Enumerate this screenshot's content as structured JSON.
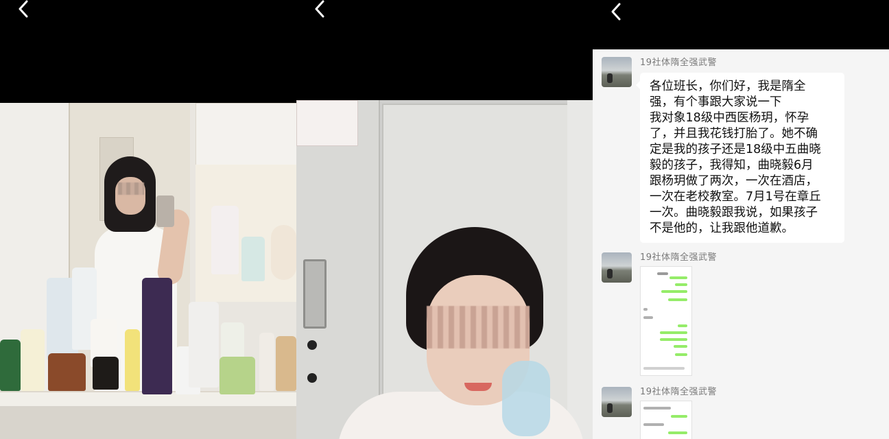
{
  "panels": [
    {
      "back_icon": "chevron-left-icon",
      "photo": "mirror-selfie"
    },
    {
      "back_icon": "chevron-left-icon",
      "photo": "locker-selfie"
    },
    {
      "back_icon": "chevron-left-icon"
    }
  ],
  "chat": {
    "messages": [
      {
        "sender": "19社体隋全强武警",
        "lines": [
          "各位班长，你们好，我是隋全",
          "强，有个事跟大家说一下",
          "我对象18级中西医杨玥，怀孕",
          "了，并且我花钱打胎了。她不确",
          "定是我的孩子还是18级中五曲晓",
          "毅的孩子，我得知，曲晓毅6月",
          "跟杨玥做了两次，一次在酒店，",
          "一次在老校教室。7月1号在章丘",
          "一次。曲晓毅跟我说，如果孩子",
          "不是他的，让我跟他道歉。"
        ]
      },
      {
        "sender": "19社体隋全强武警",
        "attachment": "chat-screenshot-image"
      },
      {
        "sender": "19社体隋全强武警",
        "attachment": "chat-screenshot-image"
      }
    ]
  },
  "colors": {
    "chat_bg": "#f5f5f5",
    "bubble_bg": "#ffffff",
    "sender_text": "#7a7a7a",
    "chat_green": "#95ec69"
  }
}
